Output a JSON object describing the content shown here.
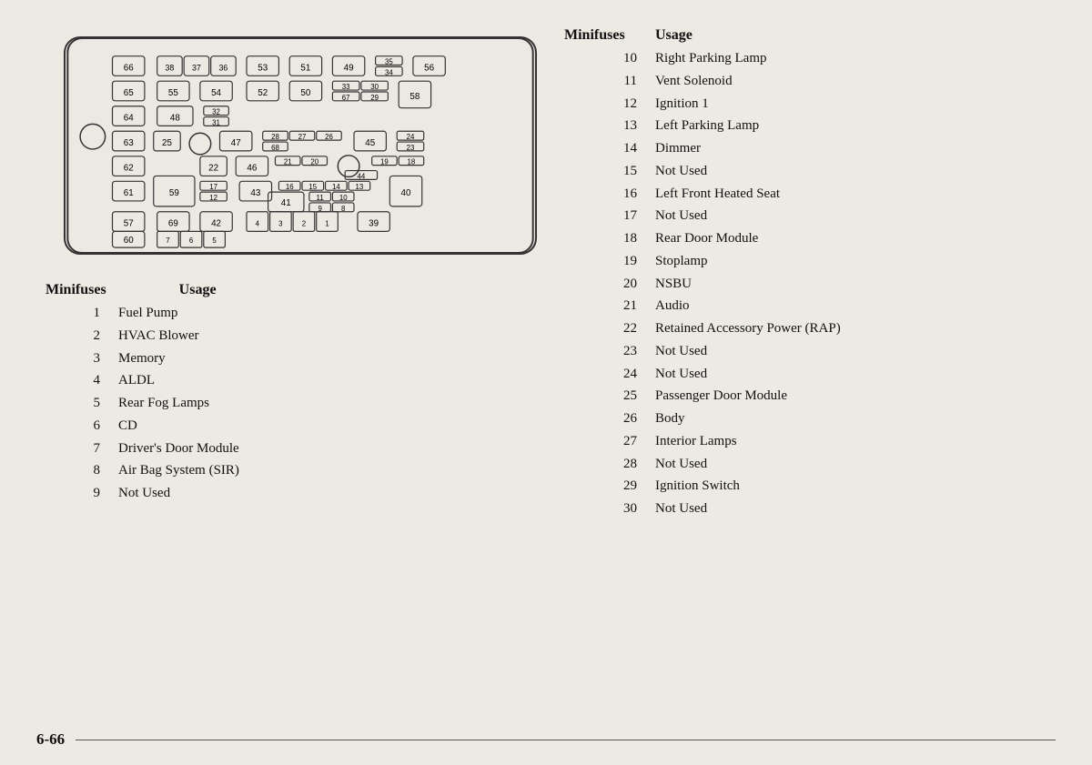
{
  "page": {
    "number": "6-66"
  },
  "left_table": {
    "header_num": "Minifuses",
    "header_usage": "Usage",
    "rows": [
      {
        "num": "1",
        "usage": "Fuel Pump"
      },
      {
        "num": "2",
        "usage": "HVAC Blower"
      },
      {
        "num": "3",
        "usage": "Memory"
      },
      {
        "num": "4",
        "usage": "ALDL"
      },
      {
        "num": "5",
        "usage": "Rear Fog Lamps"
      },
      {
        "num": "6",
        "usage": "CD"
      },
      {
        "num": "7",
        "usage": "Driver's Door Module"
      },
      {
        "num": "8",
        "usage": "Air Bag System (SIR)"
      },
      {
        "num": "9",
        "usage": "Not Used"
      }
    ]
  },
  "right_table": {
    "header_num": "Minifuses",
    "header_usage": "Usage",
    "rows": [
      {
        "num": "10",
        "usage": "Right Parking Lamp"
      },
      {
        "num": "11",
        "usage": "Vent Solenoid"
      },
      {
        "num": "12",
        "usage": "Ignition 1"
      },
      {
        "num": "13",
        "usage": "Left Parking Lamp"
      },
      {
        "num": "14",
        "usage": "Dimmer"
      },
      {
        "num": "15",
        "usage": "Not Used"
      },
      {
        "num": "16",
        "usage": "Left Front Heated Seat"
      },
      {
        "num": "17",
        "usage": "Not Used"
      },
      {
        "num": "18",
        "usage": "Rear Door Module"
      },
      {
        "num": "19",
        "usage": "Stoplamp"
      },
      {
        "num": "20",
        "usage": "NSBU"
      },
      {
        "num": "21",
        "usage": "Audio"
      },
      {
        "num": "22",
        "usage": "Retained Accessory Power (RAP)"
      },
      {
        "num": "23",
        "usage": "Not Used"
      },
      {
        "num": "24",
        "usage": "Not Used"
      },
      {
        "num": "25",
        "usage": "Passenger Door Module"
      },
      {
        "num": "26",
        "usage": "Body"
      },
      {
        "num": "27",
        "usage": "Interior Lamps"
      },
      {
        "num": "28",
        "usage": "Not Used"
      },
      {
        "num": "29",
        "usage": "Ignition Switch"
      },
      {
        "num": "30",
        "usage": "Not Used"
      }
    ]
  }
}
